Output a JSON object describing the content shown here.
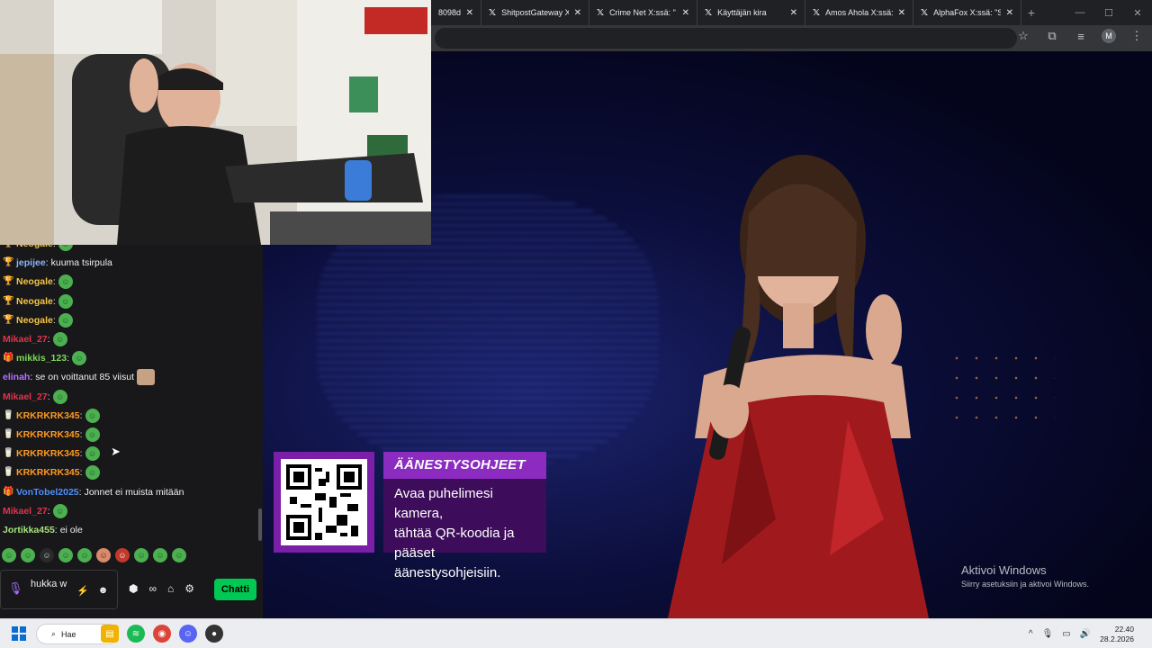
{
  "browser": {
    "tabs": [
      {
        "label": "8098d",
        "active": false
      },
      {
        "label": "ShitpostGateway X:ssä",
        "active": false
      },
      {
        "label": "Crime Net X:ssä: \"",
        "active": false
      },
      {
        "label": "Käyttäjän kira",
        "active": false
      },
      {
        "label": "Amos Ahola X:ssä: \"",
        "active": false
      },
      {
        "label": "AlphaFox X:ssä: \"She",
        "active": false
      }
    ],
    "new_tab": "+",
    "profile_initial": "M"
  },
  "chat": {
    "messages": [
      {
        "user": "Neogale",
        "text": "",
        "color": "#f5c542",
        "badge": "trophy",
        "emote": true,
        "partial": true
      },
      {
        "user": "jepijee",
        "text": "kuuma tsirpula",
        "color": "#8ab4f8",
        "badge": "trophy",
        "emote": false
      },
      {
        "user": "Neogale",
        "text": "",
        "color": "#f5c542",
        "badge": "trophy",
        "emote": true
      },
      {
        "user": "Neogale",
        "text": "",
        "color": "#f5c542",
        "badge": "trophy",
        "emote": true
      },
      {
        "user": "Neogale",
        "text": "",
        "color": "#f5c542",
        "badge": "trophy",
        "emote": true
      },
      {
        "user": "Mikael_27",
        "text": "",
        "color": "#e0344a",
        "badge": "",
        "emote": true
      },
      {
        "user": "mikkis_123",
        "text": "",
        "color": "#7ed957",
        "badge": "chest",
        "emote": true
      },
      {
        "user": "elinah",
        "text": "se on voittanut 85 viisut",
        "color": "#b072ff",
        "badge": "",
        "emote": false,
        "face": true
      },
      {
        "user": "Mikael_27",
        "text": "",
        "color": "#e0344a",
        "badge": "",
        "emote": true
      },
      {
        "user": "KRKRKRK345",
        "text": "",
        "color": "#ff9a1f",
        "badge": "glass",
        "emote": true
      },
      {
        "user": "KRKRKRK345",
        "text": "",
        "color": "#ff9a1f",
        "badge": "glass",
        "emote": true
      },
      {
        "user": "KRKRKRK345",
        "text": "",
        "color": "#ff9a1f",
        "badge": "glass",
        "emote": true
      },
      {
        "user": "KRKRKRK345",
        "text": "",
        "color": "#ff9a1f",
        "badge": "glass",
        "emote": true
      },
      {
        "user": "VonTobel2025",
        "text": "Jonnet ei muista mitään",
        "color": "#4f8ff7",
        "badge": "chest",
        "emote": false
      },
      {
        "user": "Mikael_27",
        "text": "",
        "color": "#e0344a",
        "badge": "",
        "emote": true
      },
      {
        "user": "Jortikka455",
        "text": "ei ole",
        "color": "#a6e27a",
        "badge": "",
        "emote": false
      }
    ],
    "input_text": "hukka w",
    "send_button": "Chatti"
  },
  "overlay": {
    "vote_title": "ÄÄNESTYSOHJEET",
    "vote_lines": [
      "Avaa puhelimesi kamera,",
      "tähtää QR-koodia ja",
      "pääset äänestysohjeisiin."
    ]
  },
  "watermark": {
    "line1": "Aktivoi Windows",
    "line2": "Siirry asetuksiin ja aktivoi Windows."
  },
  "taskbar": {
    "search_label": "Hae",
    "time": "22.40",
    "date": "28.2.2026"
  },
  "colors": {
    "chat_bg": "#18181b",
    "send_button": "#00c853",
    "vote_purple": "#8b2bc0"
  }
}
